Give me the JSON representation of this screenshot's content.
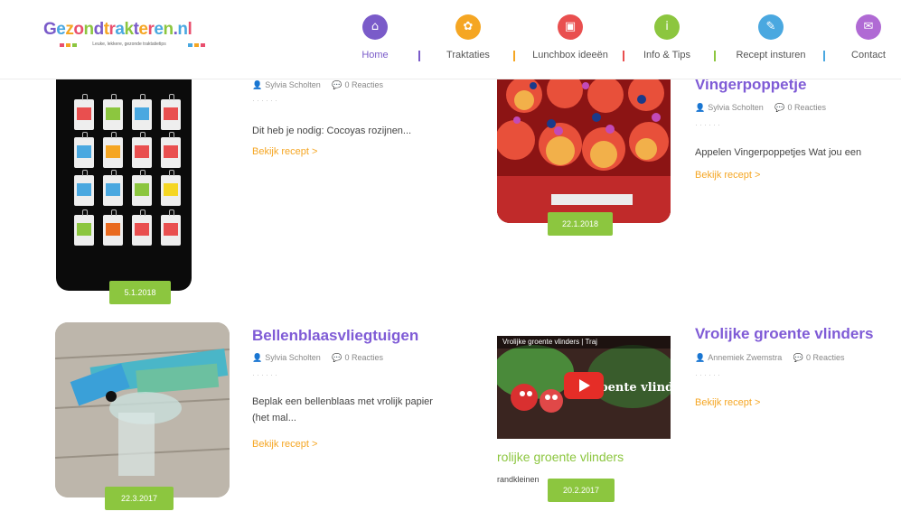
{
  "logo": {
    "letters": [
      {
        "ch": "G",
        "color": "#7a5bc9"
      },
      {
        "ch": "e",
        "color": "#4aa8e0"
      },
      {
        "ch": "z",
        "color": "#f5a623"
      },
      {
        "ch": "o",
        "color": "#e94f6e"
      },
      {
        "ch": "n",
        "color": "#8cc63f"
      },
      {
        "ch": "d",
        "color": "#7a5bc9"
      },
      {
        "ch": "t",
        "color": "#f5a623"
      },
      {
        "ch": "r",
        "color": "#e94f6e"
      },
      {
        "ch": "a",
        "color": "#4aa8e0"
      },
      {
        "ch": "k",
        "color": "#8cc63f"
      },
      {
        "ch": "t",
        "color": "#7a5bc9"
      },
      {
        "ch": "e",
        "color": "#f5a623"
      },
      {
        "ch": "r",
        "color": "#e94f6e"
      },
      {
        "ch": "e",
        "color": "#4aa8e0"
      },
      {
        "ch": "n",
        "color": "#8cc63f"
      },
      {
        "ch": ".",
        "color": "#7a5bc9"
      },
      {
        "ch": "n",
        "color": "#4aa8e0"
      },
      {
        "ch": "l",
        "color": "#e94f6e"
      }
    ],
    "tagline": "Leuke, lekkere, gezonde traktatietips"
  },
  "nav": {
    "items": [
      {
        "label": "Home",
        "icon": "home-icon",
        "glyph": "⌂",
        "color": "#7a5bc9",
        "active": true
      },
      {
        "label": "Traktaties",
        "icon": "treat-icon",
        "glyph": "✿",
        "color": "#f5a623",
        "active": false
      },
      {
        "label": "Lunchbox ideeën",
        "icon": "lunchbox-icon",
        "glyph": "▣",
        "color": "#e94f4f",
        "active": false
      },
      {
        "label": "Info & Tips",
        "icon": "info-icon",
        "glyph": "i",
        "color": "#8cc63f",
        "active": false
      },
      {
        "label": "Recept insturen",
        "icon": "send-icon",
        "glyph": "✎",
        "color": "#4aa8e0",
        "active": false
      },
      {
        "label": "Contact",
        "icon": "mail-icon",
        "glyph": "✉",
        "color": "#b06ad4",
        "active": false
      }
    ],
    "separator_colors": [
      "#7a5bc9",
      "#f5a623",
      "#e94f4f",
      "#8cc63f",
      "#4aa8e0"
    ]
  },
  "posts": [
    {
      "title": "",
      "author": "Sylvia Scholten",
      "reactions": "0 Reacties",
      "excerpt": "Dit heb je nodig: Cocoyas rozijnen...",
      "more": "Bekijk recept >",
      "date": "5.1.2018"
    },
    {
      "title": "Vingerpoppetje",
      "author": "Sylvia Scholten",
      "reactions": "0 Reacties",
      "excerpt": "Appelen Vingerpoppetjes Wat jou een",
      "more": "Bekijk recept >",
      "date": "22.1.2018"
    },
    {
      "title": "Bellenblaasvliegtuigen",
      "author": "Sylvia Scholten",
      "reactions": "0 Reacties",
      "excerpt": "Beplak een bellenblaas met vrolijk papier (het mal...",
      "more": "Bekijk recept >",
      "date": "22.3.2017"
    },
    {
      "title": "Vrolijke groente vlinders",
      "author": "Annemiek Zwemstra",
      "reactions": "0 Reacties",
      "excerpt": "",
      "more": "Bekijk recept >",
      "date": "20.2.2017",
      "video_title": "Vrolijke groente vlinders | Traj",
      "video_overlay": "groente vlinders",
      "video_caption": "rolijke groente vlinders",
      "video_credit": "randkleinen"
    }
  ],
  "tag_colors": [
    "#e94f4f",
    "#8cc63f",
    "#4aa8e0",
    "#e94f4f",
    "#4aa8e0",
    "#f5a623",
    "#e94f4f",
    "#e94f4f",
    "#4aa8e0",
    "#4aa8e0",
    "#8cc63f",
    "#f5d623",
    "#8cc63f",
    "#e96a1f",
    "#e94f4f",
    "#e94f4f"
  ]
}
